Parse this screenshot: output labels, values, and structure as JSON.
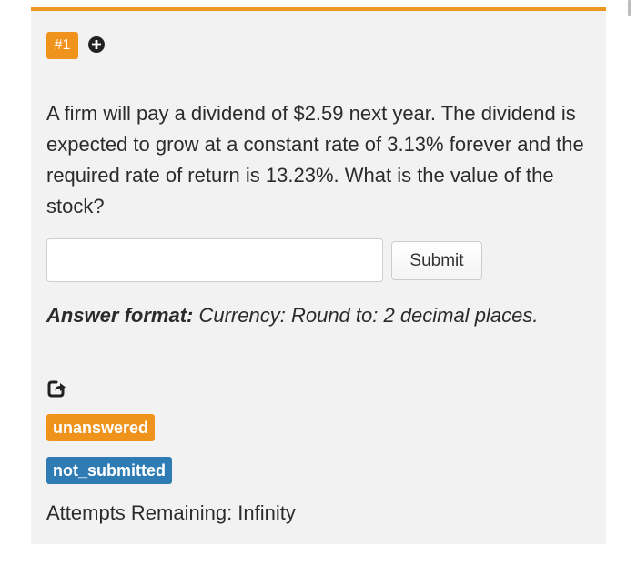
{
  "question_number": "#1",
  "question_text": "A firm will pay a dividend of $2.59 next year. The dividend is expected to grow at a constant rate of 3.13% forever and the required rate of return is 13.23%. What is the value of the stock?",
  "answer_input": {
    "value": "",
    "placeholder": ""
  },
  "submit_label": "Submit",
  "answer_format": {
    "label": "Answer format:",
    "value": "Currency: Round to: 2 decimal places."
  },
  "status_tags": {
    "answer_status": "unanswered",
    "submission_status": "not_submitted"
  },
  "attempts": "Attempts Remaining: Infinity",
  "icons": {
    "add": "plus-circle-icon",
    "share": "share-icon"
  },
  "colors": {
    "accent_orange": "#f0931c",
    "status_blue": "#2f7cb5",
    "card_background": "#f2f2f2"
  }
}
